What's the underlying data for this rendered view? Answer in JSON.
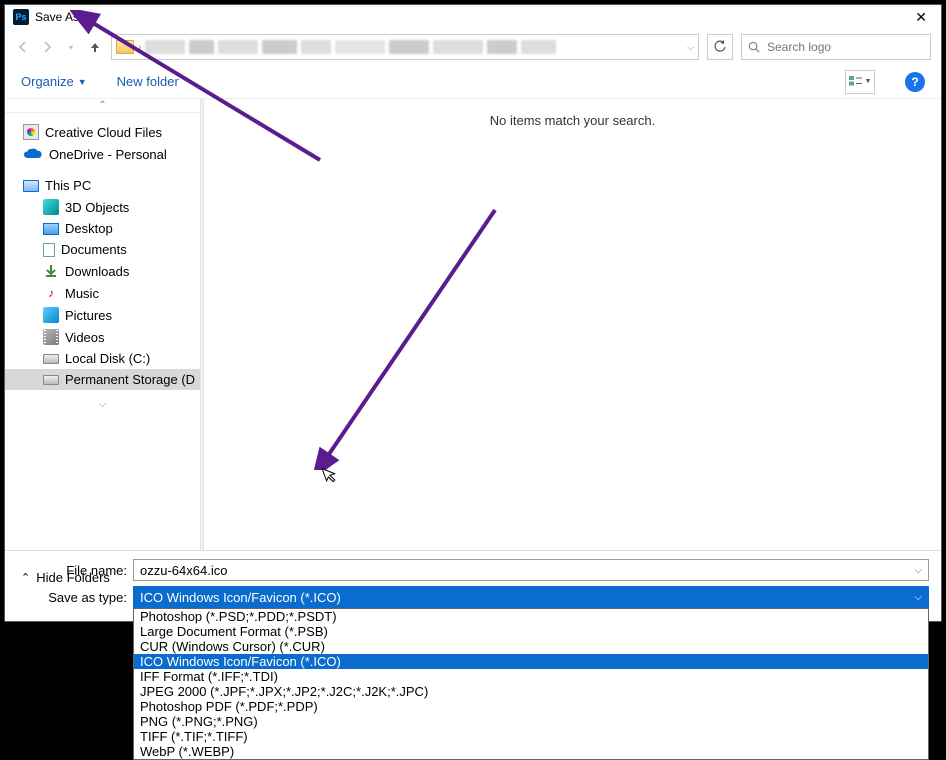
{
  "title": "Save As",
  "search_placeholder": "Search logo",
  "toolbar": {
    "organize": "Organize",
    "new_folder": "New folder"
  },
  "sidebar": {
    "items": [
      {
        "label": "Creative Cloud Files",
        "icon": "cc"
      },
      {
        "label": "OneDrive - Personal",
        "icon": "onedrive"
      },
      {
        "label": "This PC",
        "icon": "pc"
      },
      {
        "label": "3D Objects",
        "icon": "3d",
        "child": true
      },
      {
        "label": "Desktop",
        "icon": "desktop",
        "child": true
      },
      {
        "label": "Documents",
        "icon": "doc",
        "child": true
      },
      {
        "label": "Downloads",
        "icon": "dl",
        "child": true
      },
      {
        "label": "Music",
        "icon": "music",
        "child": true
      },
      {
        "label": "Pictures",
        "icon": "pic",
        "child": true
      },
      {
        "label": "Videos",
        "icon": "vid",
        "child": true
      },
      {
        "label": "Local Disk (C:)",
        "icon": "disk",
        "child": true
      },
      {
        "label": "Permanent Storage (D",
        "icon": "disk",
        "child": true,
        "selected": true
      }
    ]
  },
  "content": {
    "empty_msg": "No items match your search."
  },
  "form": {
    "filename_label": "File name:",
    "filename_value": "ozzu-64x64.ico",
    "savetype_label": "Save as type:",
    "savetype_value": "ICO Windows Icon/Favicon (*.ICO)"
  },
  "dropdown": {
    "items": [
      "Photoshop (*.PSD;*.PDD;*.PSDT)",
      "Large Document Format (*.PSB)",
      "CUR (Windows Cursor) (*.CUR)",
      "ICO Windows Icon/Favicon (*.ICO)",
      "IFF Format (*.IFF;*.TDI)",
      "JPEG 2000 (*.JPF;*.JPX;*.JP2;*.J2C;*.J2K;*.JPC)",
      "Photoshop PDF (*.PDF;*.PDP)",
      "PNG (*.PNG;*.PNG)",
      "TIFF (*.TIF;*.TIFF)",
      "WebP (*.WEBP)"
    ],
    "selected_index": 3
  },
  "hide_folders": "Hide Folders"
}
